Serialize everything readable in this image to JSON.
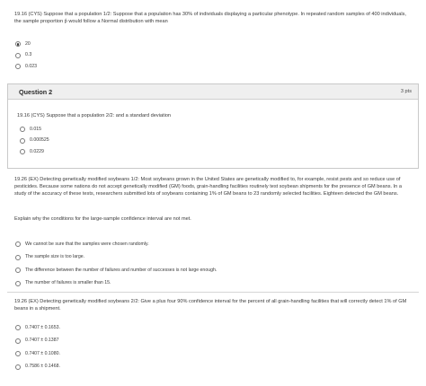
{
  "q1": {
    "text": "19.16 (CYS) Suppose that a population 1/2: Suppose that a population has 30% of individuals displaying a particular phenotype. In repeated random samples of 400 individuals, the sample proportion p̂ would follow a Normal distribution with mean",
    "options": [
      {
        "label": "20",
        "checked": true
      },
      {
        "label": "0.3",
        "checked": false
      },
      {
        "label": "0.023",
        "checked": false
      }
    ]
  },
  "question2": {
    "title": "Question 2",
    "points": "3 pts",
    "text": "19.16 (CYS) Suppose that a population 2/2: and a standard deviation",
    "options": [
      {
        "label": "0.015"
      },
      {
        "label": "0.000525"
      },
      {
        "label": "0.0229"
      }
    ]
  },
  "q3": {
    "text": "19.26 (EX) Detecting genetically modified soybeans 1/2: Most soybeans grown in the United States are genetically modified to, for example, resist pests and so reduce use of pesticides. Because some nations do not accept genetically modified (GM) foods, grain-handling facilities routinely test soybean shipments for the presence of GM beans. In a study of the accuracy of these tests, researchers submitted lots of soybeans containing 1% of GM beans to 23 randomly selected facilities. Eighteen detected the GM beans.",
    "prompt": "Explain why the conditions for the large-sample confidence interval are not met.",
    "options": [
      {
        "label": "We cannot be sure that the samples were chosen randomly."
      },
      {
        "label": "The sample size is too large."
      },
      {
        "label": "The difference between the number of failures and number of successes is not large enough."
      },
      {
        "label": "The number of failures is smaller than 15."
      }
    ]
  },
  "q4": {
    "text": "19.26 (EX) Detecting genetically modified soybeans 2/2: Give a plus four 90% confidence interval for the percent of all grain-handling facilities that will correctly detect 1% of GM beans in a shipment.",
    "options": [
      {
        "label": "0.7407 ± 0.1653."
      },
      {
        "label": "0.7407 ± 0.1387"
      },
      {
        "label": "0.7407 ± 0.1080."
      },
      {
        "label": "0.7586 ± 0.1468."
      }
    ]
  }
}
